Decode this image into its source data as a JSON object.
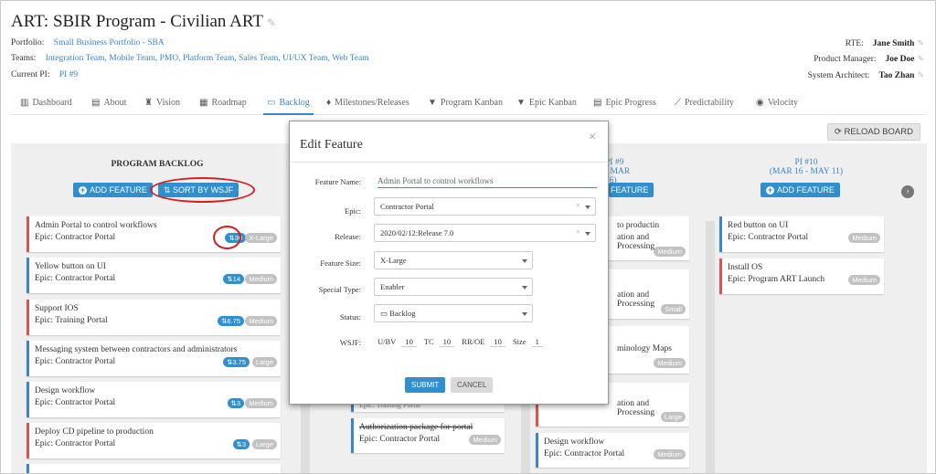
{
  "header": {
    "title": "ART:  SBIR Program - Civilian ART",
    "portfolio_label": "Portfolio:",
    "portfolio_value": "Small Business Portfolio - SBA",
    "teams_label": "Teams:",
    "teams_value": "Integration Team, Mobile Team, PMO, Platform Team, Sales Team, UI/UX Team, Web Team",
    "pi_label": "Current PI:",
    "pi_value": "PI #9",
    "rte_label": "RTE:",
    "rte_value": "Jane Smith",
    "pm_label": "Product Manager:",
    "pm_value": "Joe Doe",
    "sa_label": "System Architect:",
    "sa_value": "Tao Zhan"
  },
  "tabs": [
    {
      "label": "Dashboard",
      "icon": "chart-icon"
    },
    {
      "label": "About",
      "icon": "document-icon"
    },
    {
      "label": "Vision",
      "icon": "binoculars-icon"
    },
    {
      "label": "Roadmap",
      "icon": "map-icon"
    },
    {
      "label": "Backlog",
      "icon": "inbox-icon"
    },
    {
      "label": "Milestones/Releases",
      "icon": "diamond-icon"
    },
    {
      "label": "Program Kanban",
      "icon": "filter-icon"
    },
    {
      "label": "Epic Kanban",
      "icon": "filter-icon"
    },
    {
      "label": "Epic Progress",
      "icon": "progress-icon"
    },
    {
      "label": "Predictability",
      "icon": "line-chart-icon"
    },
    {
      "label": "Velocity",
      "icon": "gauge-icon"
    }
  ],
  "reload_label": "RELOAD BOARD",
  "backlog": {
    "title": "PROGRAM BACKLOG",
    "add_feature": "ADD FEATURE",
    "sort_wsjf": "SORT BY WSJF",
    "cards": [
      {
        "title": "Admin Portal to control workflows",
        "epic": "Epic: Contractor Portal",
        "wsjf": "30",
        "size": "X-Large"
      },
      {
        "title": "Yellow button on UI",
        "epic": "Epic: Contractor Portal",
        "wsjf": "14",
        "size": "Medium"
      },
      {
        "title": "Support IOS",
        "epic": "Epic: Training Portal",
        "wsjf": "6.75",
        "size": "Medium"
      },
      {
        "title": "Messaging system between contractors and administrators",
        "epic": "Epic: Contractor Portal",
        "wsjf": "3.75",
        "size": "Large"
      },
      {
        "title": "Design workflow",
        "epic": "Epic: Contractor Portal",
        "wsjf": "3",
        "size": "Medium"
      },
      {
        "title": "Deploy CD pipeline to production",
        "epic": "Epic: Contractor Portal",
        "wsjf": "3",
        "size": "Large"
      }
    ]
  },
  "col2": {
    "card_top": "Epic: Training Portal",
    "card_bottom_title": "Authorization package for portal",
    "card_bottom_epic": "Epic: Contractor Portal",
    "card_bottom_size": "Medium"
  },
  "pi9": {
    "title_line1": "PI #9",
    "title_line2": "- MAR 16)",
    "add_feature": "FEATURE",
    "cards": [
      {
        "title": "to productin",
        "line2": "ation and Processing",
        "size": "Medium"
      },
      {
        "title": "ation and Processing",
        "size": "Small"
      },
      {
        "title": "minology Maps",
        "size": "Medium"
      },
      {
        "title": "ation and Processing",
        "size": "Large"
      },
      {
        "title": "Design workflow",
        "epic": "Epic: Contractor Portal",
        "size": "Medium"
      }
    ]
  },
  "pi10": {
    "title_line1": "PI #10",
    "title_line2": "(MAR 16 - MAY 11)",
    "add_feature": "ADD FEATURE",
    "cards": [
      {
        "title": "Red button on UI",
        "epic": "Epic: Contractor Portal",
        "size": "Medium"
      },
      {
        "title": "Install OS",
        "epic": "Epic: Program ART Launch",
        "size": "Medium"
      }
    ]
  },
  "modal": {
    "title": "Edit Feature",
    "name_label": "Feature Name:",
    "name_value": "Admin Portal to control workflows",
    "epic_label": "Epic:",
    "epic_value": "Contractor Portal",
    "release_label": "Release:",
    "release_value": "2020/02/12:Release 7.0",
    "size_label": "Feature Size:",
    "size_value": "X-Large",
    "special_label": "Special Type:",
    "special_value": "Enabler",
    "status_label": "Status:",
    "status_value": "Backlog",
    "wsjf_label": "WSJF:",
    "ubv_label": "U/BV",
    "ubv_value": "10",
    "tc_label": "TC",
    "tc_value": "10",
    "rroe_label": "RR/OE",
    "rroe_value": "10",
    "sz_label": "Size",
    "sz_value": "1",
    "submit": "SUBMIT",
    "cancel": "CANCEL"
  }
}
